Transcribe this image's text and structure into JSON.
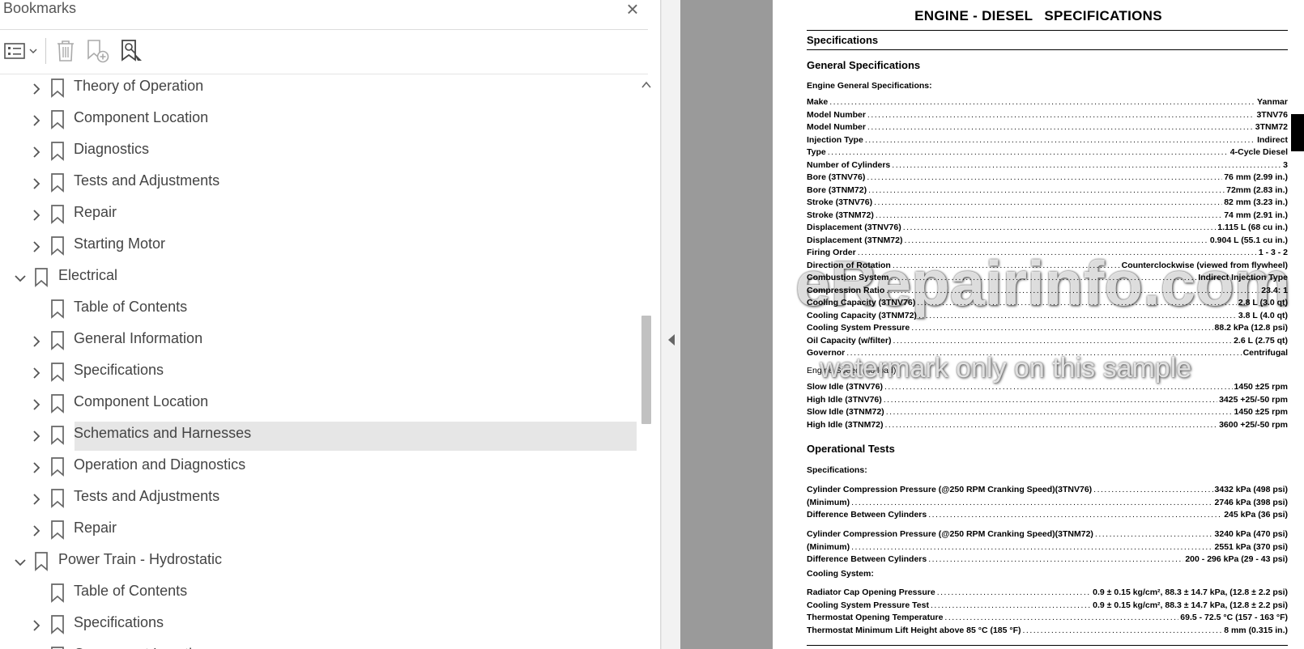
{
  "bookmarks": {
    "title": "Bookmarks",
    "close_glyph": "×",
    "toolbar": {
      "options_icon": "list-options-icon",
      "delete_icon": "trash-icon",
      "add_icon": "add-bookmark-icon",
      "find_icon": "find-bookmark-icon"
    },
    "rows": [
      {
        "label": "Theory of Operation",
        "level": 1,
        "expander": "collapsed"
      },
      {
        "label": "Component Location",
        "level": 1,
        "expander": "collapsed"
      },
      {
        "label": "Diagnostics",
        "level": 1,
        "expander": "collapsed"
      },
      {
        "label": "Tests and Adjustments",
        "level": 1,
        "expander": "collapsed"
      },
      {
        "label": "Repair",
        "level": 1,
        "expander": "collapsed"
      },
      {
        "label": "Starting Motor",
        "level": 1,
        "expander": "collapsed"
      },
      {
        "label": "Electrical",
        "level": 0,
        "expander": "expanded"
      },
      {
        "label": "Table of Contents",
        "level": 1,
        "expander": "none"
      },
      {
        "label": "General Information",
        "level": 1,
        "expander": "collapsed"
      },
      {
        "label": "Specifications",
        "level": 1,
        "expander": "collapsed"
      },
      {
        "label": "Component Location",
        "level": 1,
        "expander": "collapsed"
      },
      {
        "label": "Schematics and Harnesses",
        "level": 1,
        "expander": "collapsed",
        "selected": true
      },
      {
        "label": "Operation and Diagnostics",
        "level": 1,
        "expander": "collapsed"
      },
      {
        "label": "Tests and Adjustments",
        "level": 1,
        "expander": "collapsed"
      },
      {
        "label": "Repair",
        "level": 1,
        "expander": "collapsed"
      },
      {
        "label": "Power Train - Hydrostatic",
        "level": 0,
        "expander": "expanded"
      },
      {
        "label": "Table of Contents",
        "level": 1,
        "expander": "none"
      },
      {
        "label": "Specifications",
        "level": 1,
        "expander": "collapsed"
      },
      {
        "label": "Component Location",
        "level": 1,
        "expander": "collapsed"
      }
    ]
  },
  "document": {
    "title_part1": "ENGINE - DIESEL",
    "title_part2": "SPECIFICATIONS",
    "section_specifications": "Specifications",
    "section_general": "General Specifications",
    "engine_general_label": "Engine General Specifications:",
    "engine_general": [
      {
        "k": "Make",
        "v": "Yanmar"
      },
      {
        "k": "Model Number",
        "v": "3TNV76"
      },
      {
        "k": "Model Number",
        "v": "3TNM72"
      },
      {
        "k": "Injection Type",
        "v": "Indirect"
      },
      {
        "k": "Type",
        "v": "4-Cycle Diesel"
      },
      {
        "k": "Number of Cylinders",
        "v": "3"
      },
      {
        "k": "Bore (3TNV76)",
        "v": "76 mm (2.99 in.)"
      },
      {
        "k": "Bore (3TNM72)",
        "v": "72mm (2.83 in.)"
      },
      {
        "k": "Stroke (3TNV76)",
        "v": "82 mm (3.23 in.)"
      },
      {
        "k": "Stroke (3TNM72)",
        "v": "74 mm (2.91 in.)"
      },
      {
        "k": "Displacement (3TNV76)",
        "v": "1.115 L (68 cu in.)"
      },
      {
        "k": "Displacement (3TNM72)",
        "v": "0.904 L (55.1 cu in.)"
      },
      {
        "k": "Firing Order",
        "v": "1 - 3 - 2"
      },
      {
        "k": "Direction of Rotation",
        "v": "Counterclockwise (viewed from flywheel)"
      },
      {
        "k": "Combustion System",
        "v": "Indirect Injection Type"
      },
      {
        "k": "Compression Ratio",
        "v": "23.4: 1"
      },
      {
        "k": "Cooling Capacity (3TNV76)",
        "v": "2.8 L (3.0 qt)"
      },
      {
        "k": "Cooling Capacity (3TNM72)",
        "v": "3.8 L (4.0 qt)"
      },
      {
        "k": "Cooling System Pressure",
        "v": "88.2 kPa (12.8 psi)"
      },
      {
        "k": "Oil Capacity (w/filter)",
        "v": "2.6 L (2.75 qt)"
      },
      {
        "k": "Governor",
        "v": "Centrifugal"
      }
    ],
    "engine_speed_label": "Engine Speed (no load)",
    "engine_speed": [
      {
        "k": "Slow Idle (3TNV76)",
        "v": "1450 ±25 rpm"
      },
      {
        "k": "High Idle (3TNV76)",
        "v": "3425 +25/-50 rpm"
      },
      {
        "k": "Slow Idle (3TNM72)",
        "v": "1450 ±25 rpm"
      },
      {
        "k": "High Idle (3TNM72)",
        "v": "3600 +25/-50 rpm"
      }
    ],
    "section_operational": "Operational Tests",
    "op_specs_label": "Specifications:",
    "compression_76": [
      {
        "k": "Cylinder Compression Pressure (@250 RPM Cranking Speed)(3TNV76)",
        "v": "3432 kPa (498 psi)"
      },
      {
        "k": "(Minimum)",
        "v": "2746 kPa (398 psi)"
      },
      {
        "k": "Difference Between Cylinders",
        "v": "245 kPa (36 psi)"
      }
    ],
    "compression_72": [
      {
        "k": "Cylinder Compression Pressure (@250 RPM Cranking Speed)(3TNM72)",
        "v": "3240 kPa (470 psi)"
      },
      {
        "k": "(Minimum)",
        "v": "2551 kPa (370 psi)"
      },
      {
        "k": "Difference Between Cylinders",
        "v": "200 - 296 kPa (29 - 43 psi)"
      }
    ],
    "cooling_label": "Cooling System:",
    "cooling": [
      {
        "k": "Radiator Cap Opening Pressure",
        "v": "0.9 ± 0.15 kg/cm², 88.3 ± 14.7 kPa, (12.8 ± 2.2 psi)"
      },
      {
        "k": "Cooling System Pressure Test",
        "v": "0.9 ± 0.15 kg/cm², 88.3 ± 14.7 kPa, (12.8 ± 2.2 psi)"
      },
      {
        "k": "Thermostat Opening Temperature",
        "v": "69.5 - 72.5 °C (157 - 163 °F)"
      },
      {
        "k": "Thermostat Minimum Lift Height above 85 °C (185 °F)",
        "v": "8 mm (0.315 in.)"
      }
    ],
    "watermark_line1": "eRepairinfo.com",
    "watermark_line2": "watermark only on this sample"
  }
}
